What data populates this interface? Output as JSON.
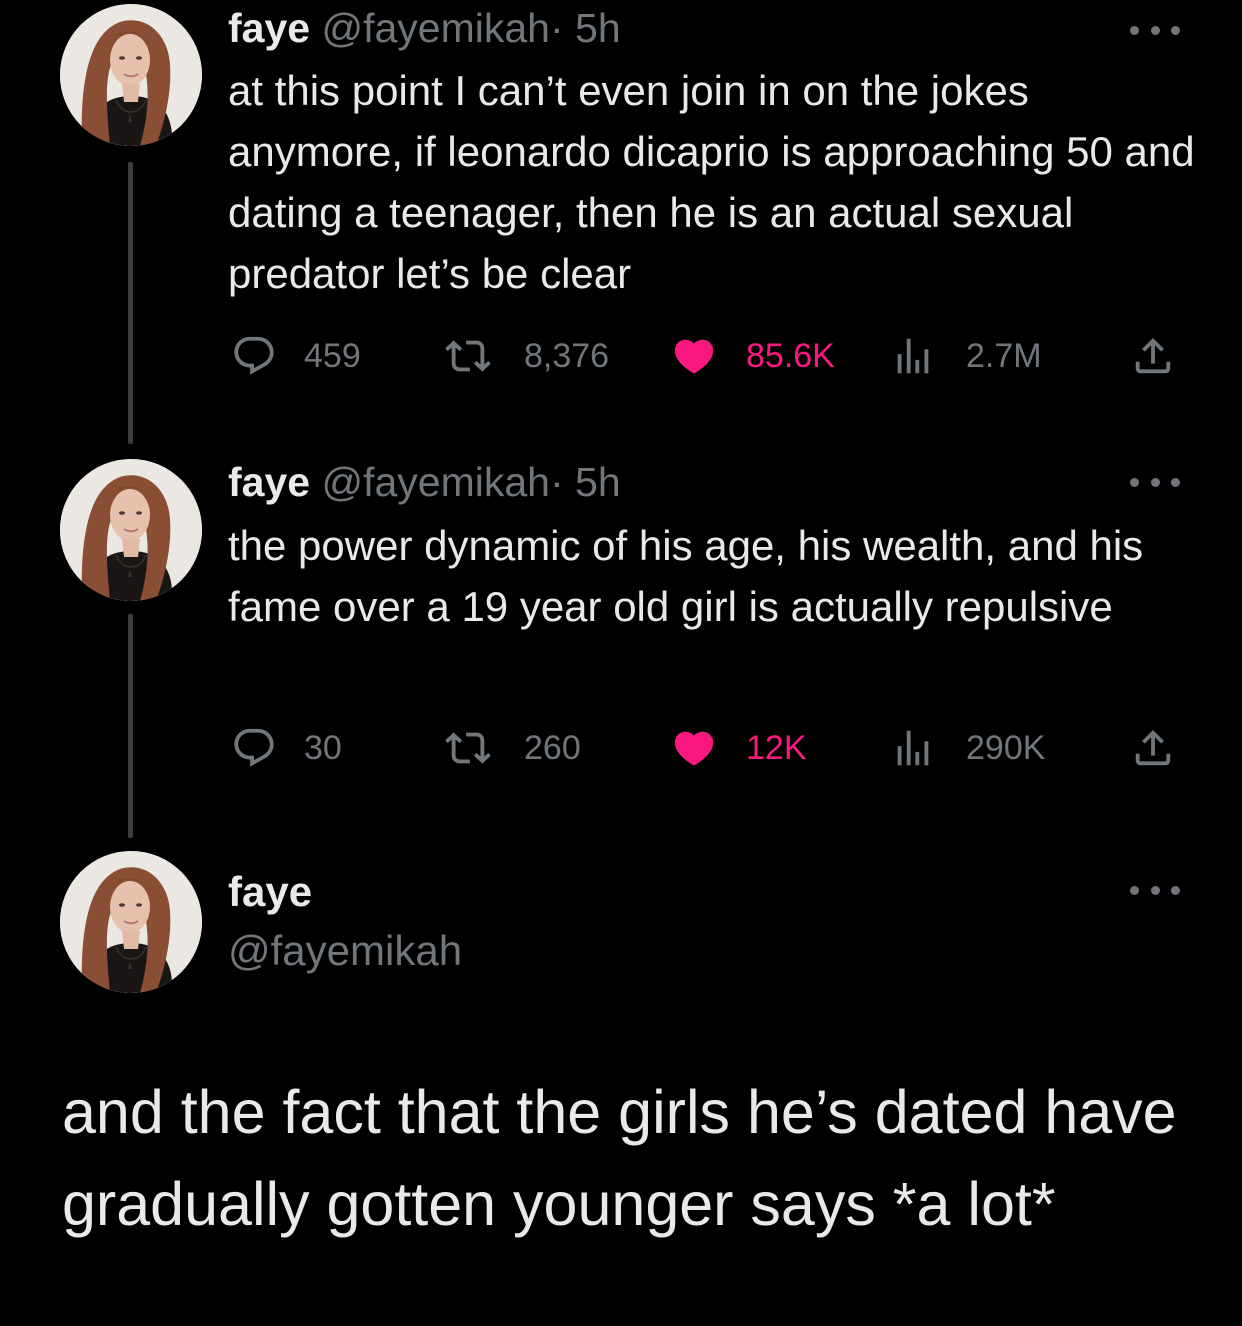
{
  "colors": {
    "background": "#000000",
    "text_primary": "#e7e9ea",
    "text_secondary": "#71767b",
    "like_active": "#f91880",
    "thread_line": "#3a3d40"
  },
  "tweets": [
    {
      "name": "faye",
      "handle": "@fayemikah",
      "separator": "·",
      "time": "5h",
      "text": "at this point I can’t even join in on the jokes anymore, if leonardo dicaprio is approaching 50 and dating a teenager, then he is an actual sexual predator let’s be clear",
      "replies": "459",
      "retweets": "8,376",
      "likes": "85.6K",
      "views": "2.7M",
      "icons": {
        "reply": "reply-icon",
        "retweet": "retweet-icon",
        "like": "heart-icon",
        "views": "views-icon",
        "share": "share-icon",
        "more": "more-icon"
      }
    },
    {
      "name": "faye",
      "handle": "@fayemikah",
      "separator": "·",
      "time": "5h",
      "text": "the power dynamic of his age, his wealth, and his fame over a 19 year old girl is actually repulsive",
      "replies": "30",
      "retweets": "260",
      "likes": "12K",
      "views": "290K",
      "icons": {
        "reply": "reply-icon",
        "retweet": "retweet-icon",
        "like": "heart-icon",
        "views": "views-icon",
        "share": "share-icon",
        "more": "more-icon"
      }
    }
  ],
  "main_tweet": {
    "name": "faye",
    "handle": "@fayemikah",
    "text": "and the fact that the girls he’s dated have gradually gotten younger says *a lot*"
  }
}
